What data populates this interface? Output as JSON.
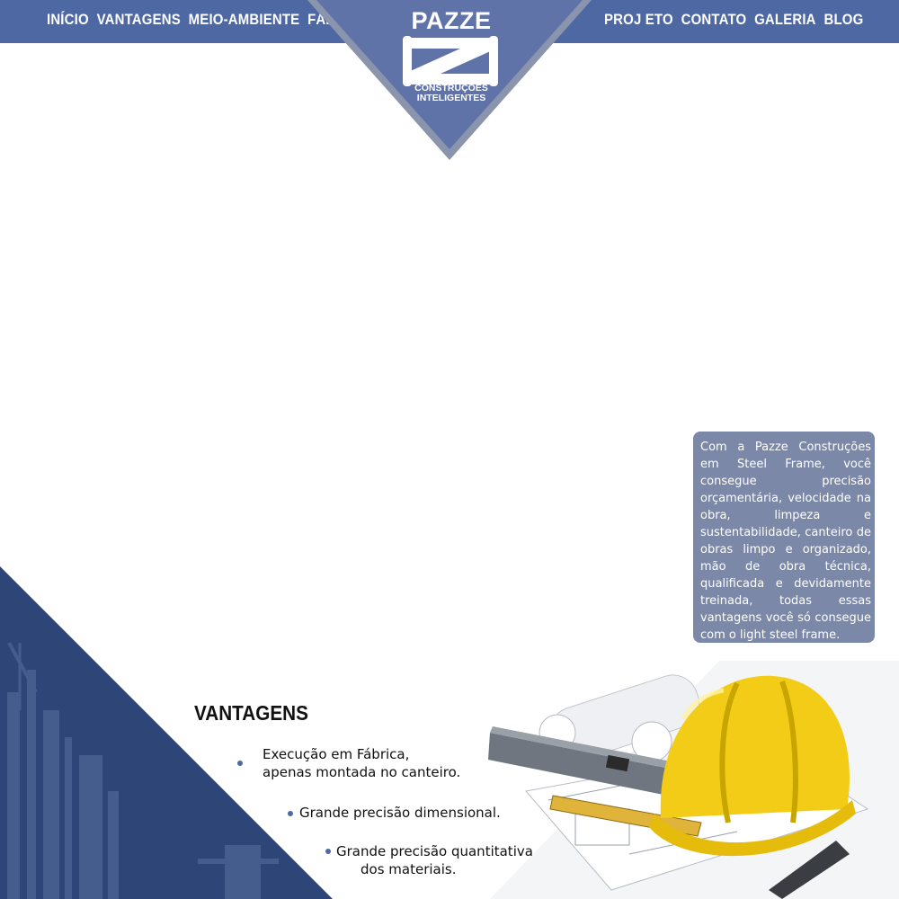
{
  "nav": {
    "left": [
      "INÍCIO",
      "VANTAGENS",
      "MEIO-AMBIENTE",
      "FÁBRICA"
    ],
    "right": [
      "PROJ ETO",
      "CONTATO",
      "GALERIA",
      "BLOG"
    ]
  },
  "logo": {
    "brand": "PAZZE",
    "tagline_line1": "CONSTRUÇÕES",
    "tagline_line2": "INTELIGENTES"
  },
  "info_box": {
    "text": "Com a Pazze Construções em Steel Frame, você consegue precisão orçamentária, velocidade na obra, limpeza e sustentabilidade, canteiro de obras limpo e organizado, mão de obra técnica, qualificada e devidamente treinada, todas essas vantagens você só consegue com o light steel frame."
  },
  "advantages": {
    "title": "VANTAGENS",
    "items": [
      {
        "line1": "Execução em Fábrica,",
        "line2": "apenas montada no canteiro."
      },
      {
        "line1": "Grande precisão dimensional."
      },
      {
        "line1": "Grande precisão quantitativa",
        "line2": "dos materiais."
      }
    ]
  },
  "colors": {
    "brand_blue": "#4e68a4",
    "dark_blue": "#2e4677",
    "box_gray": "#7b88a8",
    "helmet_yellow": "#f2cc16"
  },
  "icons": [
    "logo-z-mark",
    "construction-helmet-image",
    "industrial-building-image",
    "blueprints-image"
  ]
}
